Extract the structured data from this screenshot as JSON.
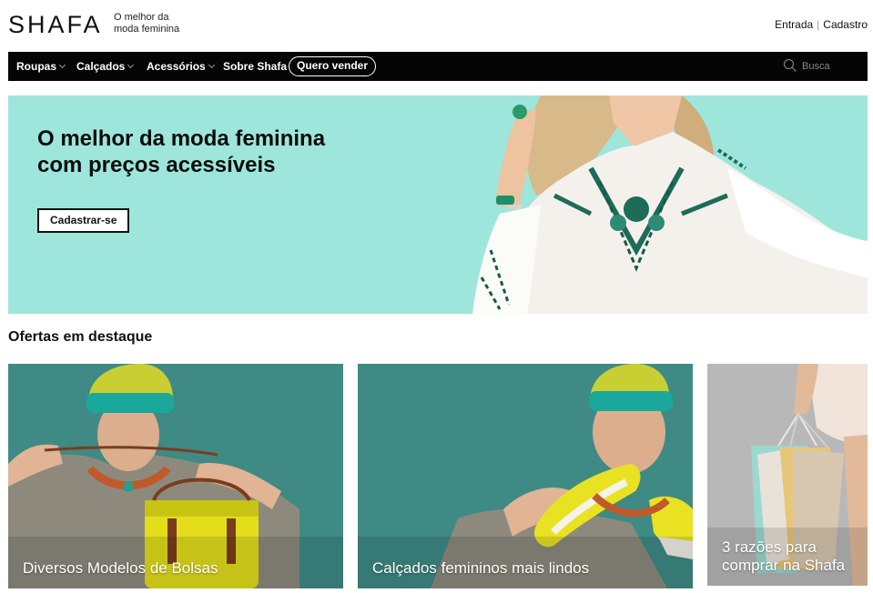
{
  "header": {
    "logo": "SHAFA",
    "tagline_line1": "O melhor da",
    "tagline_line2": "moda feminina",
    "login": "Entrada",
    "separator": "|",
    "register": "Cadastro"
  },
  "nav": {
    "items": [
      {
        "label": "Roupas",
        "has_dropdown": true
      },
      {
        "label": "Calçados",
        "has_dropdown": true
      },
      {
        "label": "Acessórios",
        "has_dropdown": true
      },
      {
        "label": "Sobre Shafa",
        "has_dropdown": false
      }
    ],
    "sell_button": "Quero vender",
    "search": {
      "placeholder": "Busca",
      "icon": "search-icon"
    }
  },
  "hero": {
    "title_line1": "O melhor da moda feminina",
    "title_line2": "com preços acessíveis",
    "cta": "Cadastrar-se",
    "background": "#9ee6dc"
  },
  "featured": {
    "title": "Ofertas em destaque",
    "cards": [
      {
        "label": "Diversos Modelos de Bolsas"
      },
      {
        "label": "Calçados femininos mais lindos"
      },
      {
        "label_line1": "3 razões para",
        "label_line2": "comprar na Shafa"
      }
    ]
  },
  "colors": {
    "navbar": "#050505",
    "hero_bg": "#9ee6dc",
    "card_teal": "#3e8c86"
  }
}
